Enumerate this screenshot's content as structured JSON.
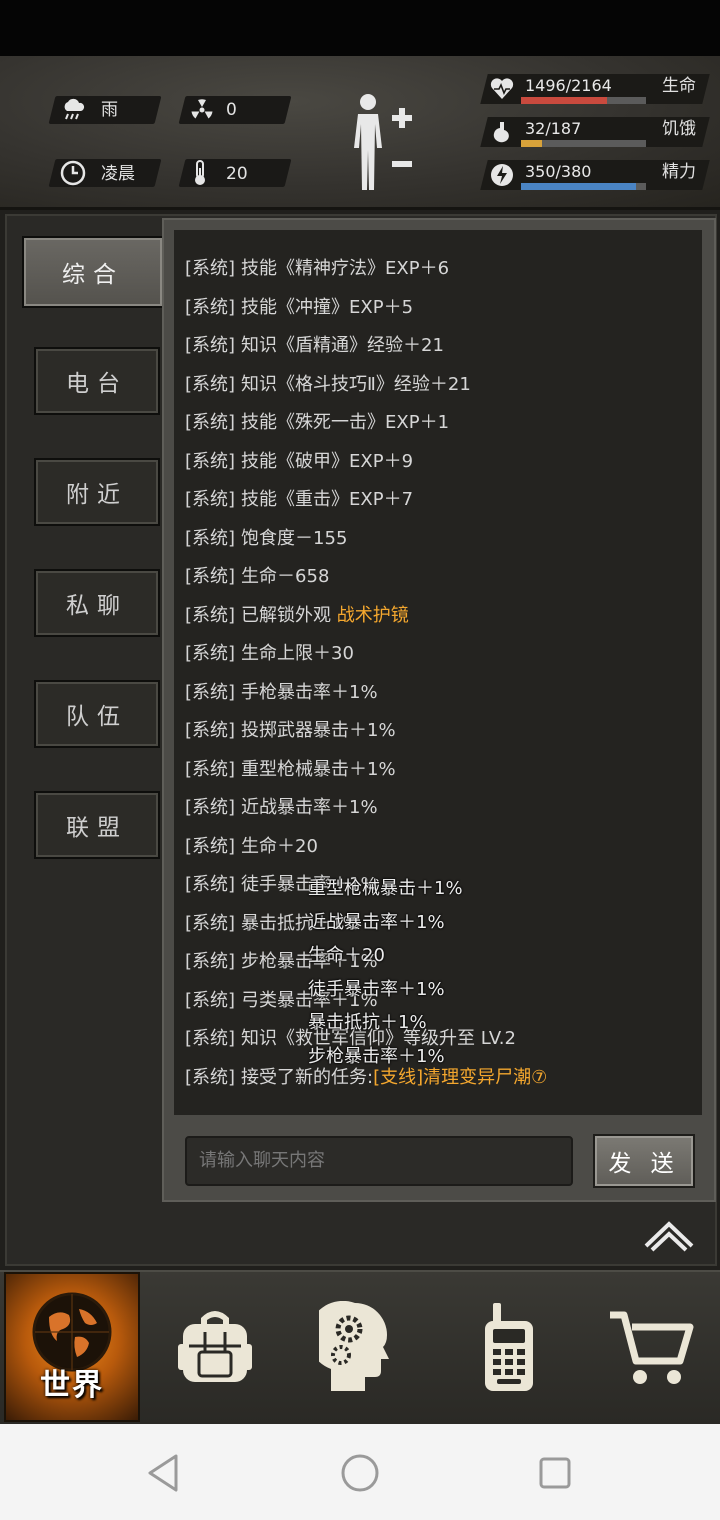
{
  "status": {
    "weather": {
      "icon": "rain-cloud-icon",
      "label": "雨"
    },
    "radiation": {
      "icon": "radiation-icon",
      "value": "0"
    },
    "time": {
      "icon": "clock-icon",
      "label": "凌晨"
    },
    "temperature": {
      "icon": "thermometer-icon",
      "value": "20"
    }
  },
  "bars": [
    {
      "name": "health",
      "value": "1496/2164",
      "label": "生命",
      "fraction": 0.69,
      "color": "#c94a3e",
      "icon": "heart-icon"
    },
    {
      "name": "hunger",
      "value": "32/187",
      "label": "饥饿",
      "fraction": 0.17,
      "color": "#d8a23a",
      "icon": "stomach-icon"
    },
    {
      "name": "energy",
      "value": "350/380",
      "label": "精力",
      "fraction": 0.92,
      "color": "#4a84c4",
      "icon": "lightning-icon"
    }
  ],
  "tabs": [
    "综合",
    "电台",
    "附近",
    "私聊",
    "队伍",
    "联盟"
  ],
  "active_tab": "综合",
  "messages": [
    {
      "prefix": "[系统]",
      "text": "技能《精神疗法》EXP＋6"
    },
    {
      "prefix": "[系统]",
      "text": "技能《冲撞》EXP＋5"
    },
    {
      "prefix": "[系统]",
      "text": "知识《盾精通》经验＋21"
    },
    {
      "prefix": "[系统]",
      "text": "知识《格斗技巧Ⅱ》经验＋21"
    },
    {
      "prefix": "[系统]",
      "text": "技能《殊死一击》EXP＋1"
    },
    {
      "prefix": "[系统]",
      "text": "技能《破甲》EXP＋9"
    },
    {
      "prefix": "[系统]",
      "text": "技能《重击》EXP＋7"
    },
    {
      "prefix": "[系统]",
      "text": "饱食度－155"
    },
    {
      "prefix": "[系统]",
      "text": "生命－658"
    },
    {
      "prefix": "[系统]",
      "text": "已解锁外观 ",
      "highlight": "战术护镜"
    },
    {
      "prefix": "[系统]",
      "text": "生命上限＋30"
    },
    {
      "prefix": "[系统]",
      "text": "手枪暴击率＋1%"
    },
    {
      "prefix": "[系统]",
      "text": "投掷武器暴击＋1%"
    },
    {
      "prefix": "[系统]",
      "text": "重型枪械暴击＋1%"
    },
    {
      "prefix": "[系统]",
      "text": "近战暴击率＋1%"
    },
    {
      "prefix": "[系统]",
      "text": "生命＋20"
    },
    {
      "prefix": "[系统]",
      "text": "徒手暴击率＋1%"
    },
    {
      "prefix": "[系统]",
      "text": "暴击抵抗＋1%"
    },
    {
      "prefix": "[系统]",
      "text": "步枪暴击率＋1%"
    },
    {
      "prefix": "[系统]",
      "text": "弓类暴击率＋1%"
    },
    {
      "prefix": "[系统]",
      "text": "知识《救世军信仰》等级升至 LV.2"
    },
    {
      "prefix": "[系统]",
      "text": "接受了新的任务:",
      "highlight": "[支线]清理变异尸潮⑦"
    }
  ],
  "floating_texts": [
    "重型枪械暴击＋1%",
    "近战暴击率＋1%",
    "生命＋20",
    "徒手暴击率＋1%",
    "暴击抵抗＋1%",
    "步枪暴击率＋1%"
  ],
  "chat": {
    "placeholder": "请输入聊天内容",
    "send_label": "发 送"
  },
  "bottom_nav": [
    {
      "name": "world",
      "label": "世界",
      "icon": "globe-icon",
      "active": true
    },
    {
      "name": "backpack",
      "icon": "backpack-icon"
    },
    {
      "name": "skills",
      "icon": "head-gears-icon"
    },
    {
      "name": "radio",
      "icon": "walkie-talkie-icon"
    },
    {
      "name": "shop",
      "icon": "shopping-cart-icon"
    }
  ],
  "colors": {
    "highlight": "#f4a72e",
    "accent_orange": "#e07a14"
  }
}
